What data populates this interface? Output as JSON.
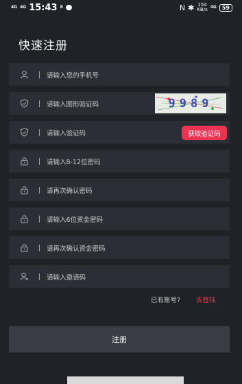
{
  "status_bar": {
    "net1": "4G",
    "net2": "4G",
    "time": "15:43",
    "chat_count": "8",
    "speed_value": "154",
    "speed_unit": "KB/s",
    "net3": "4G",
    "battery": "59"
  },
  "page": {
    "title": "快速注册"
  },
  "fields": [
    {
      "icon": "user-icon",
      "placeholder": "请输入您的手机号"
    },
    {
      "icon": "shield-icon",
      "placeholder": "请输入图形验证码"
    },
    {
      "icon": "shield-icon",
      "placeholder": "请输入验证码"
    },
    {
      "icon": "lock-icon",
      "placeholder": "请输入8-12位密码"
    },
    {
      "icon": "lock-icon",
      "placeholder": "请再次确认密码"
    },
    {
      "icon": "lock-icon",
      "placeholder": "请输入6位资金密码"
    },
    {
      "icon": "lock-icon",
      "placeholder": "请再次确认资金密码"
    },
    {
      "icon": "user-add-icon",
      "placeholder": "请输入邀请码"
    }
  ],
  "captcha": {
    "text": "9989"
  },
  "get_code_button": "获取验证码",
  "login_prompt": {
    "text": "已有账号?",
    "link": "去登陆"
  },
  "submit_button": "注册",
  "colors": {
    "background": "#1f2226",
    "field": "#2b2f35",
    "accent": "#ec3353",
    "button": "#3a3d43"
  }
}
